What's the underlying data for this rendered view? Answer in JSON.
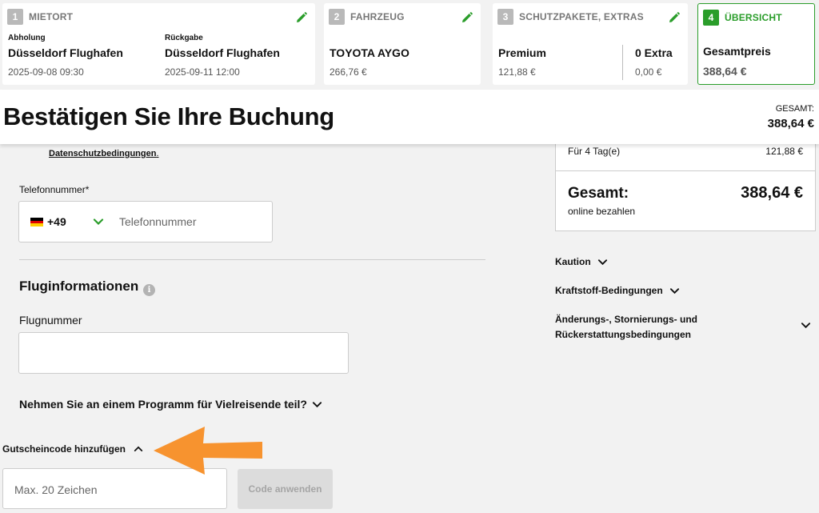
{
  "steps": [
    {
      "num": "1",
      "title": "MIETORT",
      "pickup_label": "Abholung",
      "pickup_location": "Düsseldorf Flughafen",
      "pickup_time": "2025-09-08 09:30",
      "return_label": "Rückgabe",
      "return_location": "Düsseldorf Flughafen",
      "return_time": "2025-09-11 12:00"
    },
    {
      "num": "2",
      "title": "FAHRZEUG",
      "car": "TOYOTA AYGO",
      "price": "266,76 €"
    },
    {
      "num": "3",
      "title": "SCHUTZPAKETE, EXTRAS",
      "package": "Premium",
      "package_price": "121,88 €",
      "extras": "0 Extra",
      "extras_price": "0,00 €"
    },
    {
      "num": "4",
      "title": "ÜBERSICHT",
      "label": "Gesamtpreis",
      "price": "388,64 €"
    }
  ],
  "header": {
    "title": "Bestätigen Sie Ihre Buchung",
    "total_label": "GESAMT:",
    "total_value": "388,64 €"
  },
  "form": {
    "privacy_link": "Datenschutzbedingungen",
    "privacy_suffix": ".",
    "phone_label": "Telefonnummer*",
    "country_code": "+49",
    "phone_placeholder": "Telefonnummer",
    "flight_heading": "Fluginformationen",
    "info_glyph": "i",
    "flight_label": "Flugnummer",
    "flight_value": "",
    "frequent_flyer": "Nehmen Sie an einem Programm für Vielreisende teil?"
  },
  "voucher": {
    "label": "Gutscheincode hinzufügen",
    "placeholder": "Max. 20 Zeichen",
    "button": "Code anwenden"
  },
  "summary": {
    "days_label": "Für 4 Tag(e)",
    "days_value": "121,88 €",
    "total_label": "Gesamt:",
    "total_value": "388,64 €",
    "payment_note": "online bezahlen"
  },
  "accordions": {
    "deposit": "Kaution",
    "fuel": "Kraftstoff-Bedingungen",
    "policies": "Änderungs-, Stornierungs- und Rückerstattungsbedingungen"
  },
  "colors": {
    "accent_green": "#2a9d2a",
    "annotation_arrow": "#f7932f"
  },
  "icons": [
    "pencil-icon",
    "chevron-down-icon",
    "chevron-up-icon",
    "info-icon",
    "germany-flag-icon",
    "arrow-left-icon"
  ]
}
